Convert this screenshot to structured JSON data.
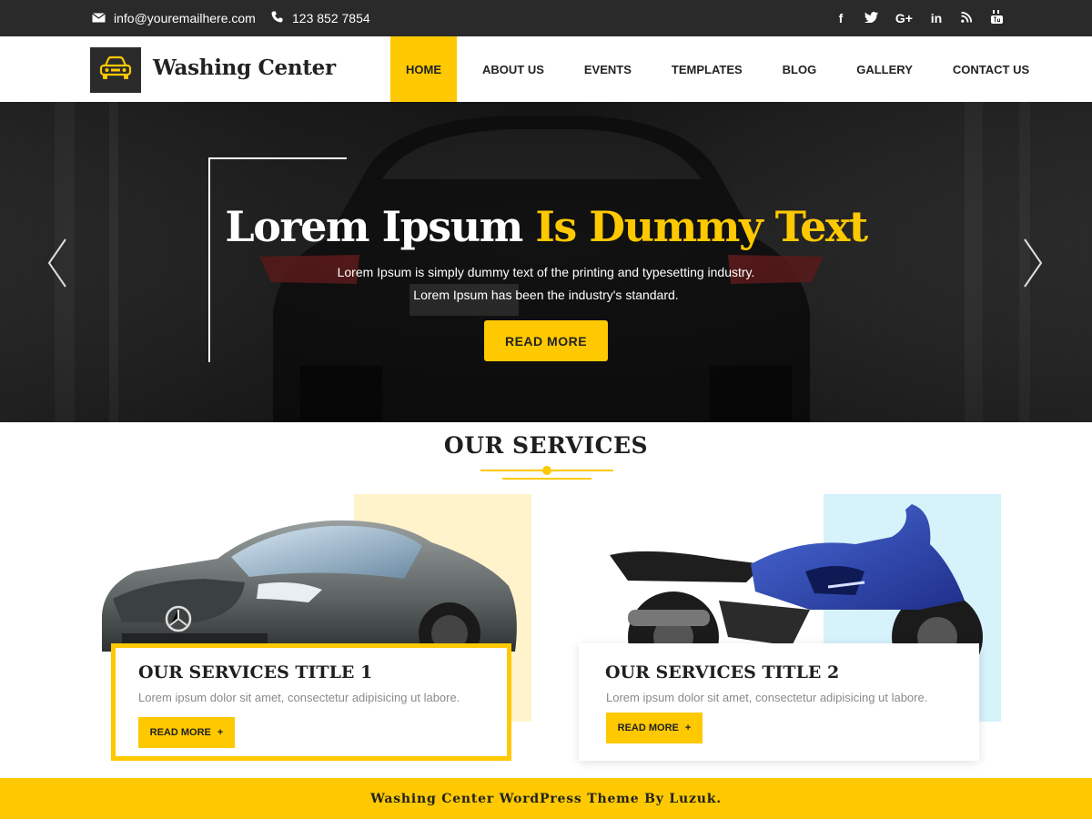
{
  "topbar": {
    "email": "info@youremailhere.com",
    "phone": "123 852 7854",
    "email_icon": "envelope-icon",
    "phone_icon": "phone-icon",
    "socials": [
      {
        "icon": "facebook-icon",
        "glyph": "f"
      },
      {
        "icon": "twitter-icon",
        "glyph": "🐦"
      },
      {
        "icon": "google-plus-icon",
        "glyph": "G+"
      },
      {
        "icon": "linkedin-icon",
        "glyph": "in"
      },
      {
        "icon": "rss-icon",
        "glyph": "◔"
      },
      {
        "icon": "youtube-icon",
        "glyph": "▶"
      }
    ]
  },
  "header": {
    "logo_text": "Washing Center",
    "logo_icon": "car-icon",
    "nav": [
      {
        "label": "HOME",
        "active": true
      },
      {
        "label": "ABOUT US"
      },
      {
        "label": "EVENTS"
      },
      {
        "label": "TEMPLATES"
      },
      {
        "label": "BLOG"
      },
      {
        "label": "GALLERY"
      },
      {
        "label": "CONTACT US"
      }
    ]
  },
  "hero": {
    "title_main": "Lorem Ipsum",
    "title_highlight": "Is Dummy Text",
    "subtitle_line1": "Lorem Ipsum is simply dummy text of the printing and typesetting industry.",
    "subtitle_line2": "Lorem Ipsum has been the industry's standard.",
    "button_label": "READ MORE",
    "prev_icon": "chevron-left-icon",
    "next_icon": "chevron-right-icon"
  },
  "services": {
    "title": "OUR SERVICES",
    "items": [
      {
        "title": "OUR SERVICES TITLE 1",
        "text": "Lorem ipsum dolor sit amet, consectetur adipisicing ut labore.",
        "button_label": "READ MORE",
        "button_icon": "plus-icon",
        "image": "car-image"
      },
      {
        "title": "OUR SERVICES TITLE 2",
        "text": "Lorem ipsum dolor sit amet, consectetur adipisicing ut labore.",
        "button_label": "READ MORE",
        "button_icon": "plus-icon",
        "image": "motorcycle-image"
      }
    ]
  },
  "footer": {
    "text": "Washing Center WordPress Theme By Luzuk."
  },
  "colors": {
    "accent": "#fec900",
    "topbar": "#2a2a2a",
    "text_dark": "#222222",
    "text_muted": "#8a8a8a",
    "service_bg_1": "#fff3cc",
    "service_bg_2": "#d6f2fb"
  }
}
